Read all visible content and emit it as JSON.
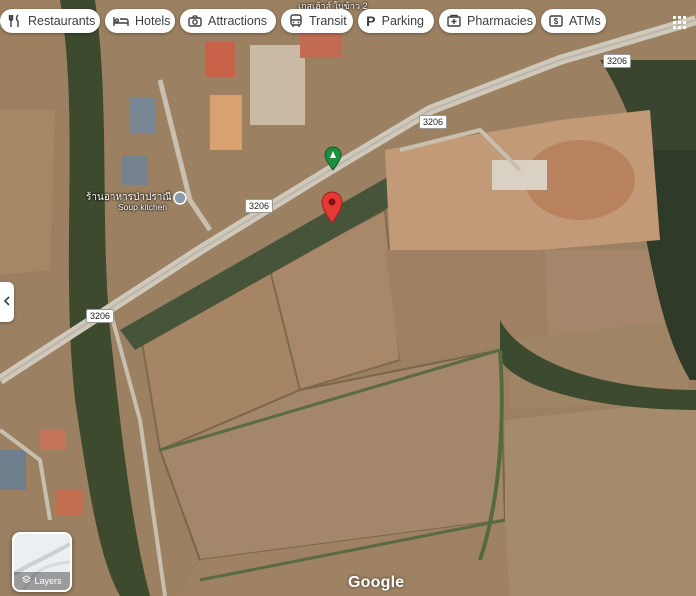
{
  "chips": [
    {
      "label": "Restaurants",
      "icon": "fork-knife-icon"
    },
    {
      "label": "Hotels",
      "icon": "bed-icon"
    },
    {
      "label": "Attractions",
      "icon": "camera-icon"
    },
    {
      "label": "Transit",
      "icon": "bus-icon"
    },
    {
      "label": "Parking",
      "icon": "parking-icon"
    },
    {
      "label": "Pharmacies",
      "icon": "pharmacy-icon"
    },
    {
      "label": "ATMs",
      "icon": "atm-icon"
    }
  ],
  "road_shields": [
    "3206",
    "3206",
    "3206",
    "3206"
  ],
  "places": {
    "restaurant_name": "ร้านอาหารป่าปราณี",
    "restaurant_sub": "Soup kitchen",
    "top_label": "เกสเฮ้าส์ ใบข้าว 2"
  },
  "layers_label": "Layers",
  "google_logo": "Google",
  "colors": {
    "chip_bg": "#ffffff",
    "pin_red": "#e53935",
    "pin_green": "#1e8e3e",
    "road": "#c9c4b8"
  }
}
